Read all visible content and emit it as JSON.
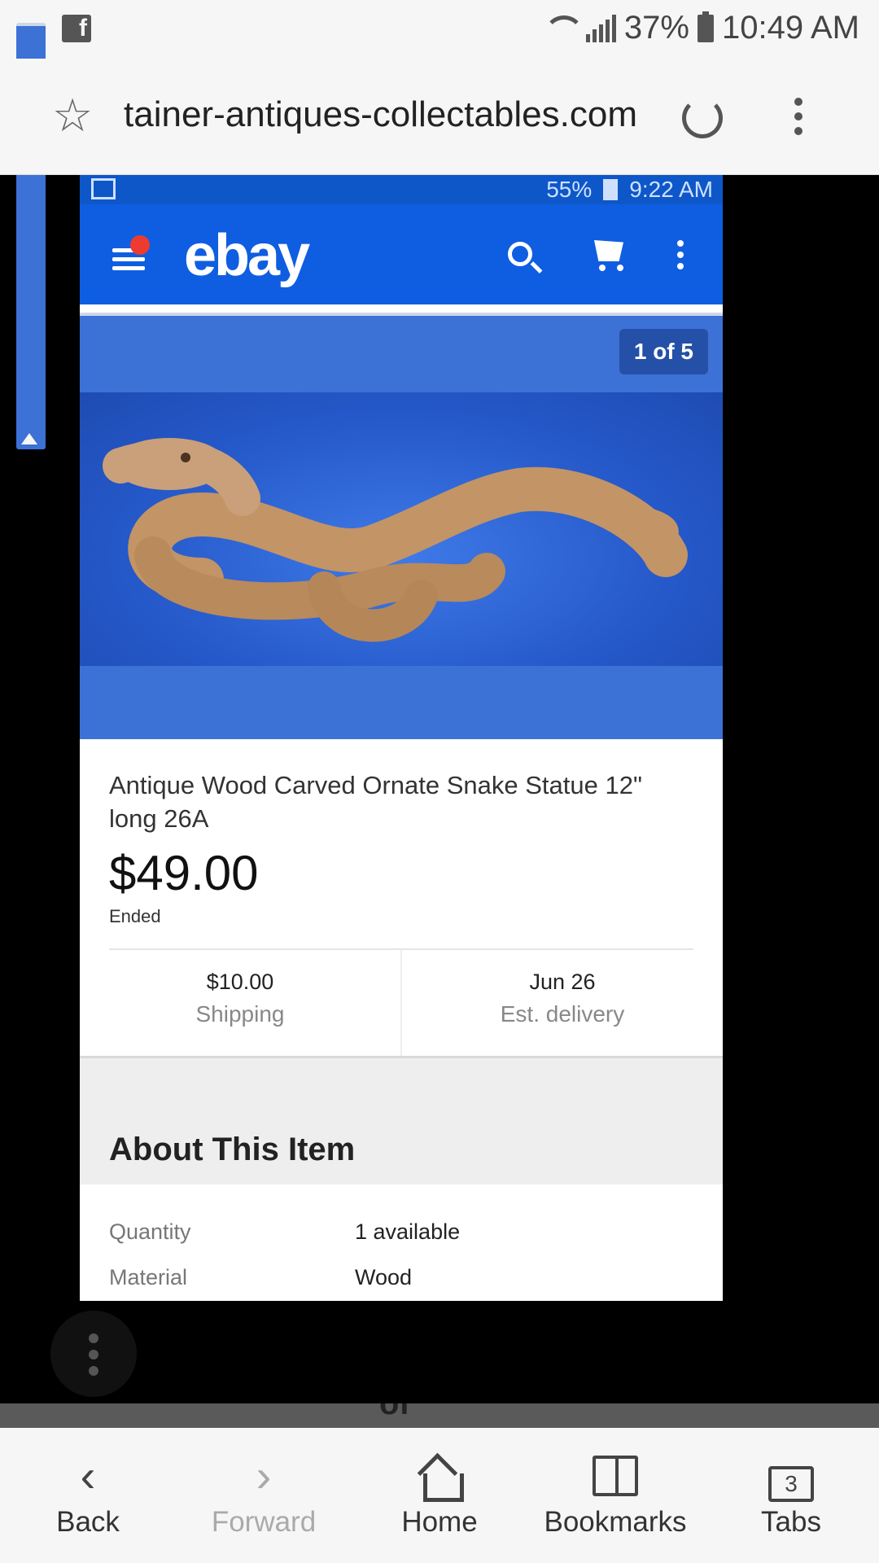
{
  "status_bar": {
    "battery": "37%",
    "time": "10:49 AM"
  },
  "browser": {
    "url": "tainer-antiques-collectables.com"
  },
  "embedded_status": {
    "battery": "55%",
    "time": "9:22 AM"
  },
  "ebay": {
    "logo": "ebay",
    "gallery_counter": "1 of 5",
    "item_title": "Antique Wood Carved Ornate Snake Statue 12\" long 26A",
    "price": "$49.00",
    "status": "Ended",
    "shipping_value": "$10.00",
    "shipping_label": "Shipping",
    "delivery_value": "Jun 26",
    "delivery_label": "Est. delivery",
    "about_title": "About This Item",
    "specs": [
      {
        "label": "Quantity",
        "value": "1 available"
      },
      {
        "label": "Material",
        "value": "Wood"
      }
    ]
  },
  "overlay_text": "of",
  "bottom_nav": {
    "back": "Back",
    "forward": "Forward",
    "home": "Home",
    "bookmarks": "Bookmarks",
    "tabs": "Tabs",
    "tab_count": "3"
  }
}
